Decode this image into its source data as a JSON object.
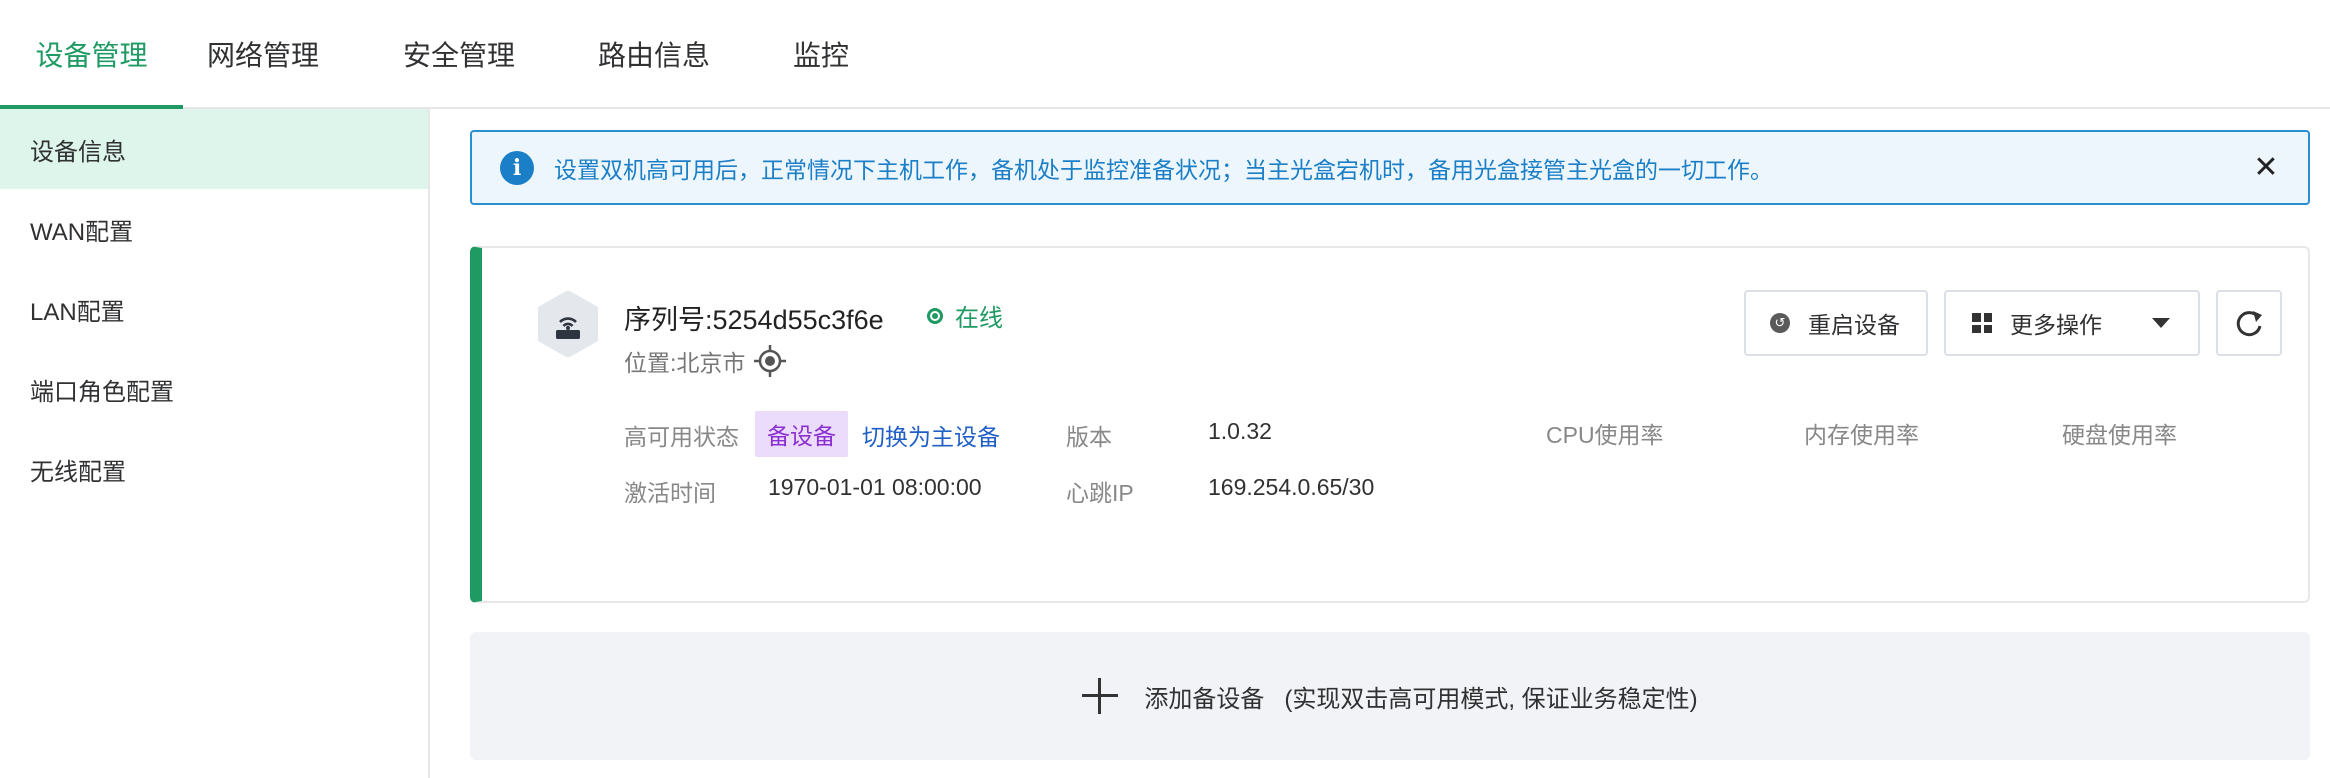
{
  "nav": {
    "tabs": [
      {
        "label": "设备管理",
        "active": true
      },
      {
        "label": "网络管理",
        "active": false
      },
      {
        "label": "安全管理",
        "active": false
      },
      {
        "label": "路由信息",
        "active": false
      },
      {
        "label": "监控",
        "active": false
      }
    ]
  },
  "sidebar": {
    "items": [
      {
        "label": "设备信息",
        "active": true
      },
      {
        "label": "WAN配置",
        "active": false
      },
      {
        "label": "LAN配置",
        "active": false
      },
      {
        "label": "端口角色配置",
        "active": false
      },
      {
        "label": "无线配置",
        "active": false
      }
    ]
  },
  "alert": {
    "icon": "info-icon",
    "text": "设置双机高可用后，正常情况下主机工作，备机处于监控准备状况；当主光盒宕机时，备用光盒接管主光盒的一切工作。"
  },
  "device": {
    "serial": "序列号:5254d55c3f6e",
    "status": "在线",
    "location": "位置:北京市",
    "ha_label": "高可用状态",
    "ha_badge": "备设备",
    "ha_switch_link": "切换为主设备",
    "activate_label": "激活时间",
    "activate_value": "1970-01-01 08:00:00",
    "version_label": "版本",
    "version_value": "1.0.32",
    "heartbeat_label": "心跳IP",
    "heartbeat_value": "169.254.0.65/30",
    "cpu_label": "CPU使用率",
    "mem_label": "内存使用率",
    "disk_label": "硬盘使用率",
    "restart_label": "重启设备",
    "more_label": "更多操作"
  },
  "add_standby": {
    "label": "添加备设备",
    "note": "(实现双击高可用模式, 保证业务稳定性)"
  },
  "colors": {
    "accent": "#1f9a63",
    "info": "#1a7fc6",
    "badge_bg": "#ecdcfb",
    "badge_text": "#8a2fd1",
    "link": "#1f5fc6"
  }
}
